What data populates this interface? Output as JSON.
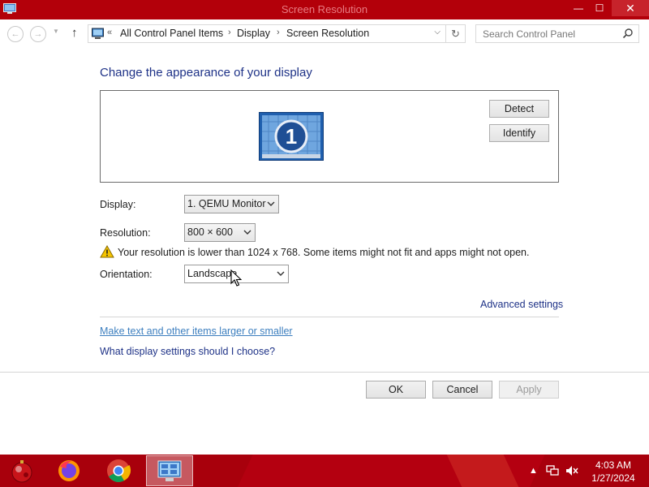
{
  "window": {
    "title": "Screen Resolution",
    "minimize_glyph": "—",
    "maximize_glyph": "☐",
    "close_glyph": "✕"
  },
  "addressbar": {
    "chevron": "«",
    "breadcrumbs": [
      "All Control Panel Items",
      "Display",
      "Screen Resolution"
    ],
    "separator": "›",
    "search_placeholder": "Search Control Panel"
  },
  "main": {
    "heading": "Change the appearance of your display",
    "monitor_number": "1",
    "detect_label": "Detect",
    "identify_label": "Identify",
    "display_label": "Display:",
    "display_value": "1. QEMU Monitor",
    "resolution_label": "Resolution:",
    "resolution_value": "800 × 600",
    "warning_text": "Your resolution is lower than 1024 x 768. Some items might not fit and apps might not open.",
    "orientation_label": "Orientation:",
    "orientation_value": "Landscape",
    "advanced_link": "Advanced settings",
    "text_size_link": "Make text and other items larger or smaller",
    "help_link": "What display settings should I choose?"
  },
  "buttons": {
    "ok": "OK",
    "cancel": "Cancel",
    "apply": "Apply"
  },
  "taskbar": {
    "pinned": [
      "start-orb-icon",
      "firefox-icon",
      "chrome-icon",
      "control-panel-icon"
    ],
    "tray_icons": [
      "chevron-up-icon",
      "network-icon",
      "volume-muted-icon"
    ],
    "time": "4:03 AM",
    "date": "1/27/2024"
  },
  "colors": {
    "titlebar": "#b3000a",
    "heading": "#1e3287",
    "link_visited": "#3d7fbf",
    "taskbar": "#a8000c"
  }
}
